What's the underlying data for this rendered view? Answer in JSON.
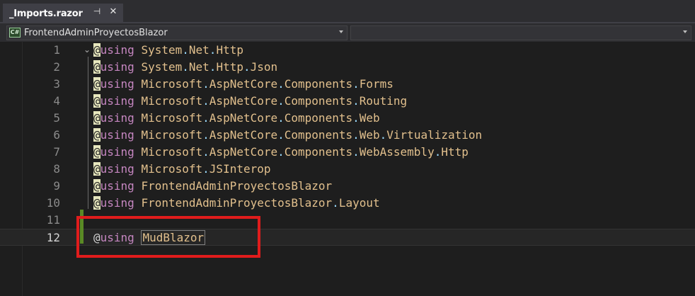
{
  "tab": {
    "title": "_Imports.razor",
    "pin_glyph": "⊣",
    "close_glyph": "✕"
  },
  "navbar": {
    "project_icon_text": "C#",
    "project": "FrontendAdminProyectosBlazor",
    "member": ""
  },
  "editor": {
    "lines": [
      {
        "number": "1",
        "keyword": "using",
        "parts": [
          "System",
          ".",
          "Net",
          ".",
          "Http"
        ]
      },
      {
        "number": "2",
        "keyword": "using",
        "parts": [
          "System",
          ".",
          "Net",
          ".",
          "Http",
          ".",
          "Json"
        ]
      },
      {
        "number": "3",
        "keyword": "using",
        "parts": [
          "Microsoft",
          ".",
          "AspNetCore",
          ".",
          "Components",
          ".",
          "Forms"
        ]
      },
      {
        "number": "4",
        "keyword": "using",
        "parts": [
          "Microsoft",
          ".",
          "AspNetCore",
          ".",
          "Components",
          ".",
          "Routing"
        ]
      },
      {
        "number": "5",
        "keyword": "using",
        "parts": [
          "Microsoft",
          ".",
          "AspNetCore",
          ".",
          "Components",
          ".",
          "Web"
        ]
      },
      {
        "number": "6",
        "keyword": "using",
        "parts": [
          "Microsoft",
          ".",
          "AspNetCore",
          ".",
          "Components",
          ".",
          "Web",
          ".",
          "Virtualization"
        ]
      },
      {
        "number": "7",
        "keyword": "using",
        "parts": [
          "Microsoft",
          ".",
          "AspNetCore",
          ".",
          "Components",
          ".",
          "WebAssembly",
          ".",
          "Http"
        ]
      },
      {
        "number": "8",
        "keyword": "using",
        "parts": [
          "Microsoft",
          ".",
          "JSInterop"
        ]
      },
      {
        "number": "9",
        "keyword": "using",
        "parts": [
          "FrontendAdminProyectosBlazor"
        ]
      },
      {
        "number": "10",
        "keyword": "using",
        "parts": [
          "FrontendAdminProyectosBlazor",
          ".",
          "Layout"
        ]
      },
      {
        "number": "11",
        "keyword": "",
        "parts": []
      },
      {
        "number": "12",
        "keyword": "using",
        "parts": [
          "MudBlazor"
        ]
      }
    ],
    "at_symbol": "@",
    "fold_glyph": "⌄",
    "current_line": 12
  },
  "colors": {
    "keyword": "#c586c0",
    "namespace": "#e2c08d",
    "annotation": "#e01c1c"
  }
}
